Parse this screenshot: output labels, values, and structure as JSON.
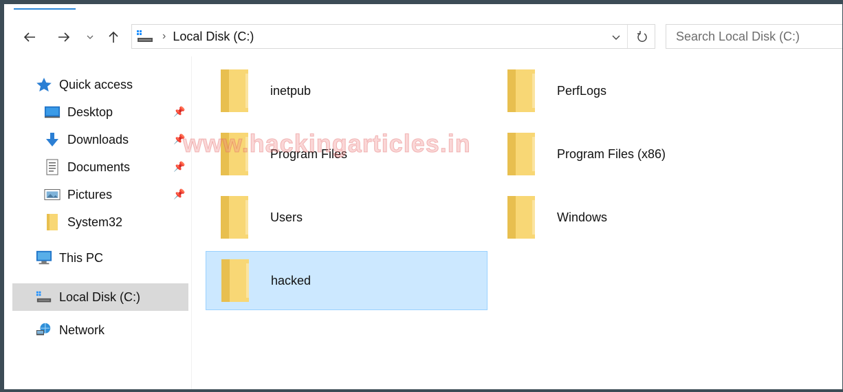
{
  "nav": {
    "back_icon": "arrow-left-icon",
    "forward_icon": "arrow-right-icon",
    "recent_icon": "chevron-down-icon",
    "up_icon": "arrow-up-icon"
  },
  "address": {
    "drive_icon": "local-disk-icon",
    "path": "Local Disk (C:)",
    "separator": "›"
  },
  "search": {
    "placeholder": "Search Local Disk (C:)"
  },
  "sidebar": {
    "quick_access": "Quick access",
    "items": [
      {
        "label": "Desktop",
        "icon": "desktop-icon",
        "pinned": true
      },
      {
        "label": "Downloads",
        "icon": "downloads-icon",
        "pinned": true
      },
      {
        "label": "Documents",
        "icon": "documents-icon",
        "pinned": true
      },
      {
        "label": "Pictures",
        "icon": "pictures-icon",
        "pinned": true
      },
      {
        "label": "System32",
        "icon": "folder-icon",
        "pinned": false
      }
    ],
    "this_pc": "This PC",
    "local_disk": "Local Disk (C:)",
    "network": "Network"
  },
  "folders": [
    {
      "name": "inetpub"
    },
    {
      "name": "PerfLogs"
    },
    {
      "name": "Program Files"
    },
    {
      "name": "Program Files (x86)"
    },
    {
      "name": "Users"
    },
    {
      "name": "Windows"
    },
    {
      "name": "hacked",
      "selected": true
    }
  ],
  "watermark": "www.hackingarticles.in",
  "colors": {
    "frame": "#3c4c56",
    "selection": "#cce8ff",
    "selection_border": "#99d1ff",
    "folder": "#f8d775",
    "accent": "#2a86d8"
  }
}
